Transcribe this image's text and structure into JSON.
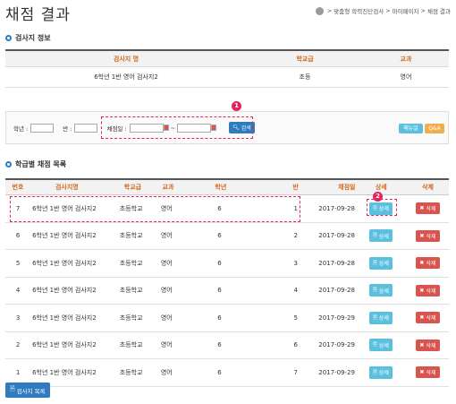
{
  "page": {
    "title": "채점 결과"
  },
  "breadcrumb": [
    "맞춤형 학력진단검사",
    "마이페이지",
    "채점 결과"
  ],
  "exam_info": {
    "section_title": "검사지 정보",
    "headers": [
      "검사지 명",
      "학교급",
      "교과"
    ],
    "row": [
      "6학년 1반 영어 검사지2",
      "초등",
      "영어"
    ]
  },
  "filter": {
    "grade_label": "학년 :",
    "class_label": "반 :",
    "date_label": "채점일 :",
    "date_sep": "~",
    "search_label": "검색",
    "manual_label": "매뉴얼",
    "qa_label": "Q&A"
  },
  "steps": [
    "1",
    "2"
  ],
  "list": {
    "section_title": "학급별 채점 목록",
    "headers": [
      "번호",
      "검사지명",
      "학교급",
      "교과",
      "학년",
      "반",
      "채점일",
      "상세",
      "삭제"
    ],
    "detail_label": "상세",
    "delete_label": "삭제",
    "rows": [
      [
        "7",
        "6학년 1반 영어 검사지2",
        "초등학교",
        "영어",
        "6",
        "1",
        "2017-09-28"
      ],
      [
        "6",
        "6학년 1반 영어 검사지2",
        "초등학교",
        "영어",
        "6",
        "2",
        "2017-09-28"
      ],
      [
        "5",
        "6학년 1반 영어 검사지2",
        "초등학교",
        "영어",
        "6",
        "3",
        "2017-09-28"
      ],
      [
        "4",
        "6학년 1반 영어 검사지2",
        "초등학교",
        "영어",
        "6",
        "4",
        "2017-09-28"
      ],
      [
        "3",
        "6학년 1반 영어 검사지2",
        "초등학교",
        "영어",
        "6",
        "5",
        "2017-09-29"
      ],
      [
        "2",
        "6학년 1반 영어 검사지2",
        "초등학교",
        "영어",
        "6",
        "6",
        "2017-09-29"
      ],
      [
        "1",
        "6학년 1반 영어 검사지2",
        "초등학교",
        "영어",
        "6",
        "7",
        "2017-09-29"
      ]
    ]
  },
  "bottom": {
    "list_button": "검사지 목록"
  },
  "colors": {
    "accent_blue": "#2e7bbf",
    "header_orange": "#d2691e",
    "highlight_pink": "#e5235a",
    "detail_cyan": "#5bc0de",
    "delete_red": "#d9534f"
  },
  "icons": {
    "home": "home-icon",
    "section": "circle-bullet-icon",
    "search": "search-icon",
    "calendar": "calendar-icon",
    "document": "document-icon",
    "close": "close-icon"
  }
}
